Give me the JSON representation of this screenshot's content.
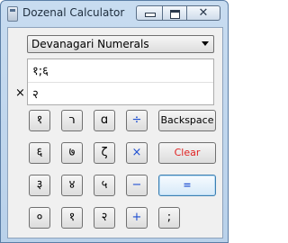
{
  "window": {
    "title": "Dozenal Calculator",
    "close_glyph": "✕"
  },
  "numeral_system": {
    "selected": "Devanagari Numerals"
  },
  "display": {
    "value": "१;६",
    "entry": "२",
    "operator": "×"
  },
  "keypad": {
    "row1": [
      "१",
      "ר",
      "ɑ",
      "÷",
      "Backspace"
    ],
    "row2": [
      "६",
      "७",
      "ζ",
      "×",
      "Clear"
    ],
    "row3": [
      "३",
      "४",
      "५",
      "−",
      "="
    ],
    "row4": [
      "०",
      "१",
      "२",
      "+",
      ";"
    ]
  },
  "colors": {
    "operator": "#1f4fd1",
    "clear": "#e02020",
    "accent": "#3c7fb1"
  }
}
